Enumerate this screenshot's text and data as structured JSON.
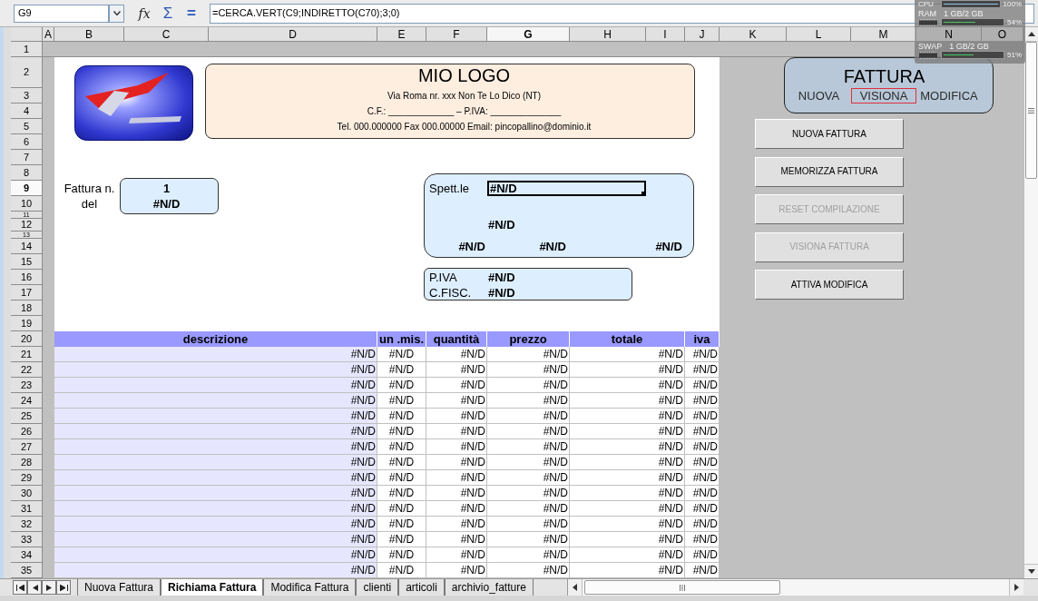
{
  "formula_bar": {
    "name_box": "G9",
    "tools": [
      {
        "kind": "function",
        "glyph": "fx"
      },
      {
        "kind": "sum",
        "glyph": "Σ"
      },
      {
        "kind": "equals",
        "glyph": "="
      }
    ],
    "formula": "=CERCA.VERT(C9;INDIRETTO(C70);3;0)"
  },
  "system_monitor": {
    "meters": [
      {
        "label": "CPU",
        "reading": "100%",
        "level": 1,
        "color": "#8cc4ec"
      },
      {
        "label": "RAM",
        "detail": "1 GB/2 GB",
        "reading": "54%",
        "level": 0.54,
        "color": "#46c864"
      },
      {
        "label": "SWAP",
        "detail": "1 GB/2 GB",
        "reading": "51%",
        "level": 0.51,
        "color": "#46c864"
      }
    ]
  },
  "columns": [
    {
      "label": "A",
      "selected": false
    },
    {
      "label": "B",
      "selected": false
    },
    {
      "label": "C",
      "selected": false
    },
    {
      "label": "D",
      "selected": false
    },
    {
      "label": "E",
      "selected": false
    },
    {
      "label": "F",
      "selected": false
    },
    {
      "label": "G",
      "selected": true
    },
    {
      "label": "H",
      "selected": false
    },
    {
      "label": "I",
      "selected": false
    },
    {
      "label": "J",
      "selected": false
    },
    {
      "label": "K",
      "selected": false
    },
    {
      "label": "L",
      "selected": false
    },
    {
      "label": "M",
      "selected": false
    },
    {
      "label": "N",
      "selected": false
    },
    {
      "label": "O",
      "selected": false
    }
  ],
  "rows": [
    {
      "label": "1",
      "selected": false
    },
    {
      "label": "2",
      "selected": false
    },
    {
      "label": "3",
      "selected": false
    },
    {
      "label": "4",
      "selected": false
    },
    {
      "label": "5",
      "selected": false
    },
    {
      "label": "6",
      "selected": false
    },
    {
      "label": "7",
      "selected": false
    },
    {
      "label": "8",
      "selected": false
    },
    {
      "label": "9",
      "selected": true
    },
    {
      "label": "10",
      "selected": false
    },
    {
      "label": "11",
      "selected": false
    },
    {
      "label": "12",
      "selected": false
    },
    {
      "label": "13",
      "selected": false
    },
    {
      "label": "14",
      "selected": false
    },
    {
      "label": "15",
      "selected": false
    },
    {
      "label": "16",
      "selected": false
    },
    {
      "label": "17",
      "selected": false
    },
    {
      "label": "18",
      "selected": false
    },
    {
      "label": "19",
      "selected": false
    },
    {
      "label": "20",
      "selected": false
    },
    {
      "label": "21",
      "selected": false
    },
    {
      "label": "22",
      "selected": false
    },
    {
      "label": "23",
      "selected": false
    },
    {
      "label": "24",
      "selected": false
    },
    {
      "label": "25",
      "selected": false
    },
    {
      "label": "26",
      "selected": false
    },
    {
      "label": "27",
      "selected": false
    },
    {
      "label": "28",
      "selected": false
    },
    {
      "label": "29",
      "selected": false
    },
    {
      "label": "30",
      "selected": false
    },
    {
      "label": "31",
      "selected": false
    },
    {
      "label": "32",
      "selected": false
    },
    {
      "label": "33",
      "selected": false
    },
    {
      "label": "34",
      "selected": false
    },
    {
      "label": "35",
      "selected": false
    }
  ],
  "company_box": {
    "title": "MIO LOGO",
    "lines": [
      "Via Roma nr. xxx Non Te Lo Dico (NT)",
      "C.F.: _____________ – P.IVA: ______________",
      "Tel. 000.000000 Fax 000.00000 Email: pincopallino@dominio.it"
    ]
  },
  "invoice": {
    "number_label": "Fattura n.",
    "date_label": "del",
    "number": "1",
    "date": "#N/D"
  },
  "recipient": {
    "label": "Spett.le",
    "fields": [
      "#N/D",
      "#N/D",
      "#N/D",
      "#N/D",
      "#N/D"
    ]
  },
  "tax_ids": [
    {
      "label": "P.IVA",
      "value": "#N/D"
    },
    {
      "label": "C.FISC.",
      "value": "#N/D"
    }
  ],
  "mode_panel": {
    "title": "FATTURA",
    "modes": [
      {
        "label": "NUOVA",
        "selected": false
      },
      {
        "label": "VISIONA",
        "selected": true
      },
      {
        "label": "MODIFICA",
        "selected": false
      }
    ]
  },
  "buttons": [
    {
      "label": "NUOVA FATTURA",
      "disabled": false
    },
    {
      "label": "MEMORIZZA FATTURA",
      "disabled": false
    },
    {
      "label": "RESET COMPILAZIONE",
      "disabled": true
    },
    {
      "label": "VISIONA FATTURA",
      "disabled": true
    },
    {
      "label": "ATTIVA MODIFICA",
      "disabled": false
    }
  ],
  "items_table": {
    "columns": [
      "descrizione",
      "un .mis.",
      "quantità",
      "prezzo",
      "totale",
      "iva"
    ],
    "rows": [
      [
        "#N/D",
        "#N/D",
        "#N/D",
        "#N/D",
        "#N/D",
        "#N/D"
      ],
      [
        "#N/D",
        "#N/D",
        "#N/D",
        "#N/D",
        "#N/D",
        "#N/D"
      ],
      [
        "#N/D",
        "#N/D",
        "#N/D",
        "#N/D",
        "#N/D",
        "#N/D"
      ],
      [
        "#N/D",
        "#N/D",
        "#N/D",
        "#N/D",
        "#N/D",
        "#N/D"
      ],
      [
        "#N/D",
        "#N/D",
        "#N/D",
        "#N/D",
        "#N/D",
        "#N/D"
      ],
      [
        "#N/D",
        "#N/D",
        "#N/D",
        "#N/D",
        "#N/D",
        "#N/D"
      ],
      [
        "#N/D",
        "#N/D",
        "#N/D",
        "#N/D",
        "#N/D",
        "#N/D"
      ],
      [
        "#N/D",
        "#N/D",
        "#N/D",
        "#N/D",
        "#N/D",
        "#N/D"
      ],
      [
        "#N/D",
        "#N/D",
        "#N/D",
        "#N/D",
        "#N/D",
        "#N/D"
      ],
      [
        "#N/D",
        "#N/D",
        "#N/D",
        "#N/D",
        "#N/D",
        "#N/D"
      ],
      [
        "#N/D",
        "#N/D",
        "#N/D",
        "#N/D",
        "#N/D",
        "#N/D"
      ],
      [
        "#N/D",
        "#N/D",
        "#N/D",
        "#N/D",
        "#N/D",
        "#N/D"
      ],
      [
        "#N/D",
        "#N/D",
        "#N/D",
        "#N/D",
        "#N/D",
        "#N/D"
      ],
      [
        "#N/D",
        "#N/D",
        "#N/D",
        "#N/D",
        "#N/D",
        "#N/D"
      ],
      [
        "#N/D",
        "#N/D",
        "#N/D",
        "#N/D",
        "#N/D",
        "#N/D"
      ]
    ]
  },
  "sheet_tabs": [
    {
      "label": "Nuova Fattura",
      "selected": false
    },
    {
      "label": "Richiama Fattura",
      "selected": true
    },
    {
      "label": "Modifica Fattura",
      "selected": false
    },
    {
      "label": "clienti",
      "selected": false
    },
    {
      "label": "articoli",
      "selected": false
    },
    {
      "label": "archivio_fatture",
      "selected": false
    }
  ]
}
